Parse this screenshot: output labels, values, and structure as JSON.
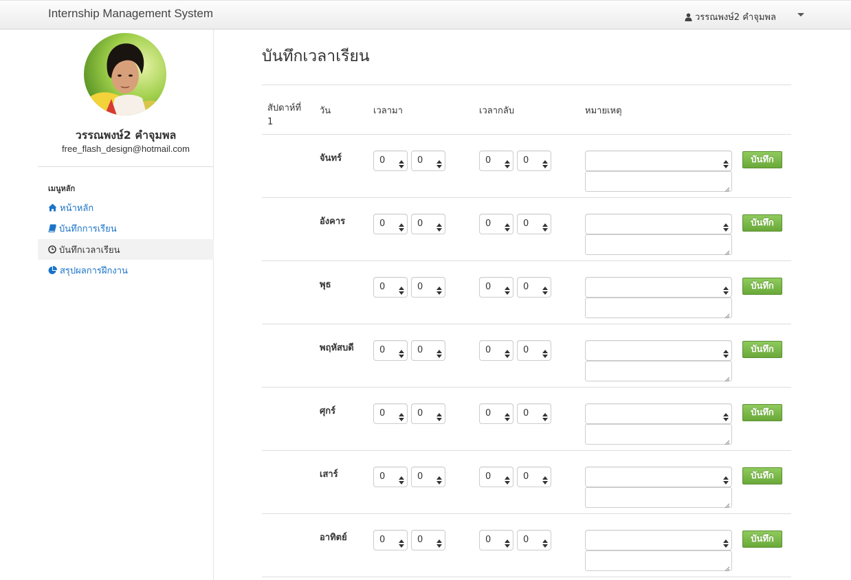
{
  "navbar": {
    "brand": "Internship Management System",
    "user_name": "วรรณพงษ์2 คำจุมพล"
  },
  "profile": {
    "name": "วรรณพงษ์2 คำจุมพล",
    "email": "free_flash_design@hotmail.com"
  },
  "menu": {
    "header": "เมนูหลัก",
    "items": [
      {
        "label": "หน้าหลัก",
        "icon": "home-icon"
      },
      {
        "label": "บันทึกการเรียน",
        "icon": "book-icon"
      },
      {
        "label": "บันทึกเวลาเรียน",
        "icon": "clock-icon",
        "active": true
      },
      {
        "label": "สรุปผลการฝึกงาน",
        "icon": "pie-chart-icon"
      }
    ]
  },
  "page": {
    "title": "บันทึกเวลาเรียน"
  },
  "table": {
    "headers": {
      "week": "สัปดาห์ที่ 1",
      "day": "วัน",
      "time_in": "เวลามา",
      "time_out": "เวลากลับ",
      "note": "หมายเหตุ"
    },
    "rows": [
      {
        "day": "จันทร์",
        "in_h": "0",
        "in_m": "0",
        "out_h": "0",
        "out_m": "0",
        "note_select": "",
        "note_text": "",
        "save": "บันทึก"
      },
      {
        "day": "อังคาร",
        "in_h": "0",
        "in_m": "0",
        "out_h": "0",
        "out_m": "0",
        "note_select": "",
        "note_text": "",
        "save": "บันทึก"
      },
      {
        "day": "พุธ",
        "in_h": "0",
        "in_m": "0",
        "out_h": "0",
        "out_m": "0",
        "note_select": "",
        "note_text": "",
        "save": "บันทึก"
      },
      {
        "day": "พฤหัสบดี",
        "in_h": "0",
        "in_m": "0",
        "out_h": "0",
        "out_m": "0",
        "note_select": "",
        "note_text": "",
        "save": "บันทึก"
      },
      {
        "day": "ศุกร์",
        "in_h": "0",
        "in_m": "0",
        "out_h": "0",
        "out_m": "0",
        "note_select": "",
        "note_text": "",
        "save": "บันทึก"
      },
      {
        "day": "เสาร์",
        "in_h": "0",
        "in_m": "0",
        "out_h": "0",
        "out_m": "0",
        "note_select": "",
        "note_text": "",
        "save": "บันทึก"
      },
      {
        "day": "อาทิตย์",
        "in_h": "0",
        "in_m": "0",
        "out_h": "0",
        "out_m": "0",
        "note_select": "",
        "note_text": "",
        "save": "บันทึก"
      }
    ]
  },
  "colors": {
    "link": "#1a73c8",
    "save_button": "#7ab84a"
  }
}
